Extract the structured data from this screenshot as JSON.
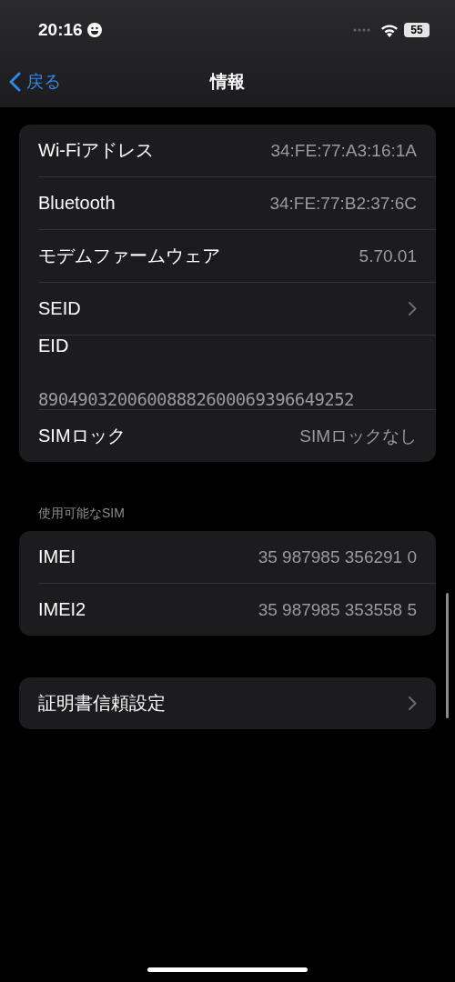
{
  "status_bar": {
    "time": "20:16",
    "battery": "55"
  },
  "nav": {
    "back": "戻る",
    "title": "情報"
  },
  "sections": [
    {
      "rows": [
        {
          "kind": "value",
          "label": "Wi-Fiアドレス",
          "value": "34:FE:77:A3:16:1A"
        },
        {
          "kind": "value",
          "label": "Bluetooth",
          "value": "34:FE:77:B2:37:6C"
        },
        {
          "kind": "value",
          "label": "モデムファームウェア",
          "value": "5.70.01"
        },
        {
          "kind": "link",
          "label": "SEID"
        },
        {
          "kind": "stacked",
          "label": "EID",
          "value": "89049032006008882600069396649252"
        },
        {
          "kind": "value",
          "label": "SIMロック",
          "value": "SIMロックなし"
        }
      ]
    },
    {
      "header": "使用可能なSIM",
      "rows": [
        {
          "kind": "value",
          "label": "IMEI",
          "value": "35 987985 356291 0"
        },
        {
          "kind": "value",
          "label": "IMEI2",
          "value": "35 987985 353558 5"
        }
      ]
    },
    {
      "rows": [
        {
          "kind": "link",
          "label": "証明書信頼設定"
        }
      ]
    }
  ]
}
